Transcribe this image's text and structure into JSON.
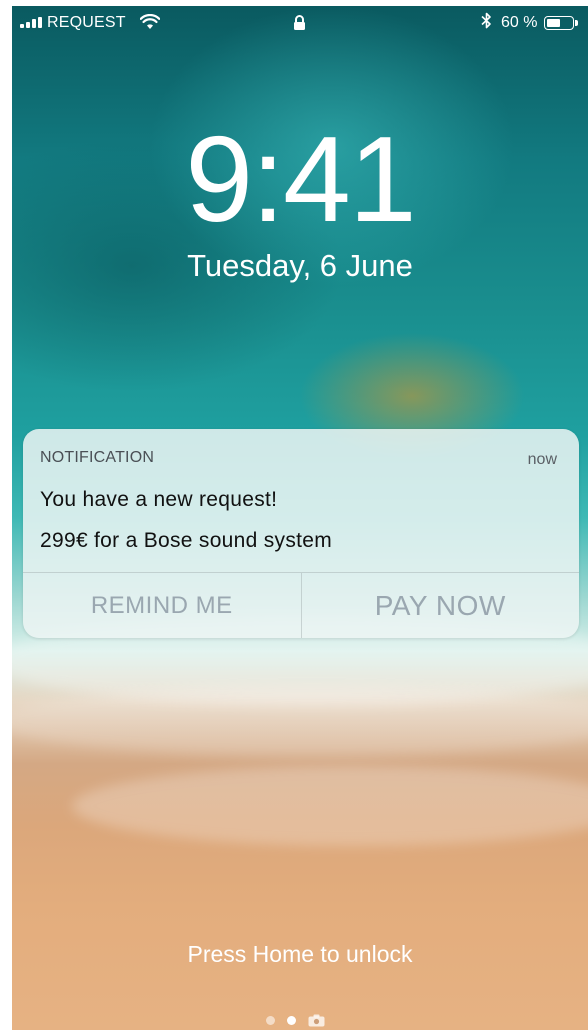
{
  "status_bar": {
    "carrier": "REQUEST",
    "battery_percent_label": "60 %",
    "battery_level": 0.6,
    "icons": [
      "signal-icon",
      "wifi-icon",
      "lock-icon",
      "bluetooth-icon",
      "battery-icon"
    ]
  },
  "lock_screen": {
    "time": "9:41",
    "date": "Tuesday, 6 June",
    "unlock_hint": "Press Home to unlock"
  },
  "notification": {
    "app_name": "NOTIFICATION",
    "time": "now",
    "title": "You have a new request!",
    "body": "299€ for a Bose sound system",
    "actions": [
      {
        "label": "REMIND ME"
      },
      {
        "label": "PAY NOW"
      }
    ]
  },
  "page_indicator": {
    "pages": 3,
    "active_index": 1,
    "icons": [
      "camera-icon"
    ]
  }
}
